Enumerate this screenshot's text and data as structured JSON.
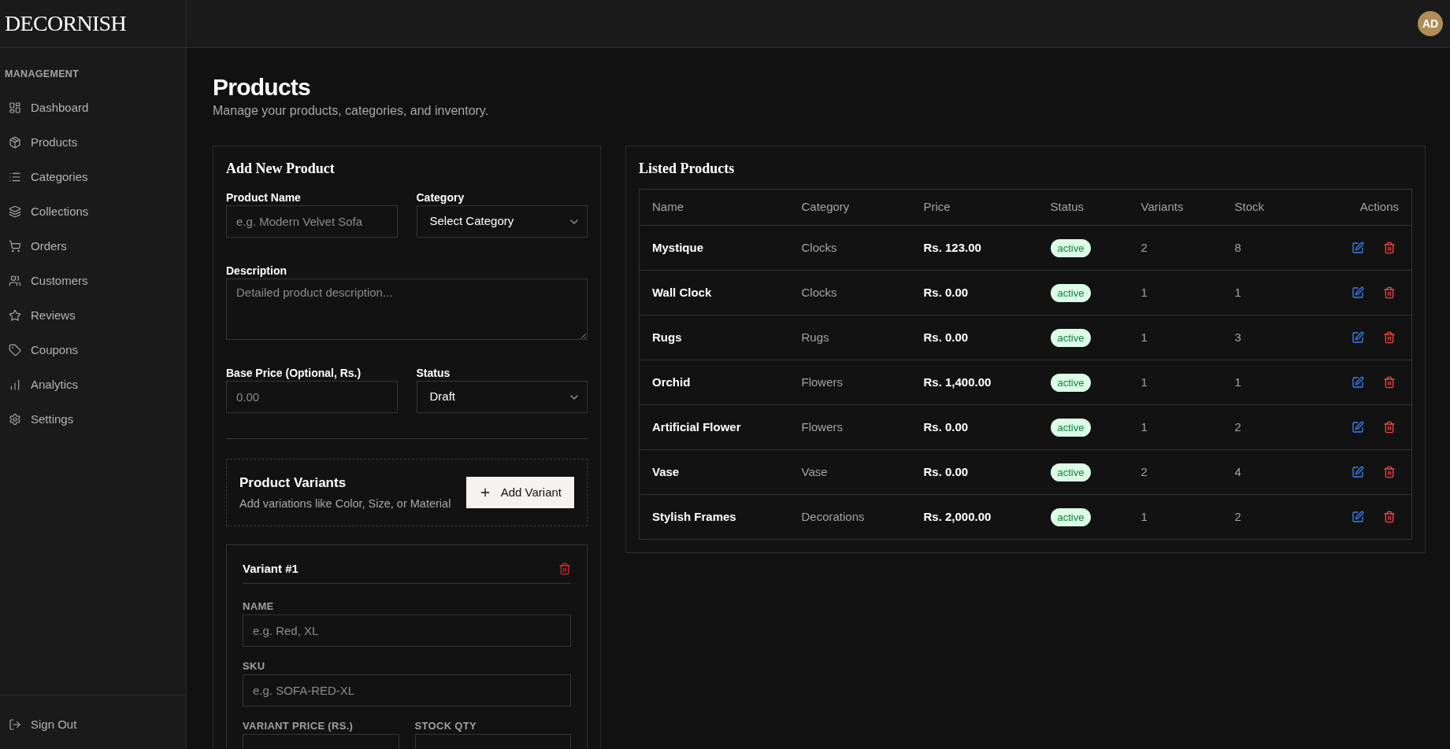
{
  "sidebar": {
    "logo": "DECORNISH",
    "section_label": "MANAGEMENT",
    "items": [
      "Dashboard",
      "Products",
      "Categories",
      "Collections",
      "Orders",
      "Customers",
      "Reviews",
      "Coupons",
      "Analytics",
      "Settings"
    ],
    "footer_item": "Sign Out"
  },
  "header": {
    "avatar_initials": "AD"
  },
  "page": {
    "title": "Products",
    "subtitle": "Manage your products, categories, and inventory."
  },
  "add_product_form": {
    "title": "Add New Product",
    "product_name": {
      "label": "Product Name",
      "placeholder": "e.g. Modern Velvet Sofa"
    },
    "category": {
      "label": "Category",
      "value": "Select Category"
    },
    "description": {
      "label": "Description",
      "placeholder": "Detailed product description..."
    },
    "base_price": {
      "label": "Base Price (Optional, Rs.)",
      "placeholder": "0.00"
    },
    "status": {
      "label": "Status",
      "value": "Draft"
    },
    "variants_section": {
      "title": "Product Variants",
      "subtitle": "Add variations like Color, Size, or Material",
      "add_button": "Add Variant"
    },
    "variants": [
      {
        "title": "Variant #1",
        "name": {
          "label": "NAME",
          "placeholder": "e.g. Red, XL"
        },
        "sku": {
          "label": "SKU",
          "placeholder": "e.g. SOFA-RED-XL"
        },
        "price": {
          "label": "VARIANT PRICE (RS.)"
        },
        "stock": {
          "label": "STOCK QTY"
        }
      }
    ]
  },
  "listed_products": {
    "title": "Listed Products",
    "columns": [
      "Name",
      "Category",
      "Price",
      "Status",
      "Variants",
      "Stock",
      "Actions"
    ],
    "rows": [
      {
        "name": "Mystique",
        "category": "Clocks",
        "price": "Rs. 123.00",
        "status": "active",
        "variants": "2",
        "stock": "8"
      },
      {
        "name": "Wall Clock",
        "category": "Clocks",
        "price": "Rs. 0.00",
        "status": "active",
        "variants": "1",
        "stock": "1"
      },
      {
        "name": "Rugs",
        "category": "Rugs",
        "price": "Rs. 0.00",
        "status": "active",
        "variants": "1",
        "stock": "3"
      },
      {
        "name": "Orchid",
        "category": "Flowers",
        "price": "Rs. 1,400.00",
        "status": "active",
        "variants": "1",
        "stock": "1"
      },
      {
        "name": "Artificial Flower",
        "category": "Flowers",
        "price": "Rs. 0.00",
        "status": "active",
        "variants": "1",
        "stock": "2"
      },
      {
        "name": "Vase",
        "category": "Vase",
        "price": "Rs. 0.00",
        "status": "active",
        "variants": "2",
        "stock": "4"
      },
      {
        "name": "Stylish Frames",
        "category": "Decorations",
        "price": "Rs. 2,000.00",
        "status": "active",
        "variants": "1",
        "stock": "2"
      }
    ]
  }
}
